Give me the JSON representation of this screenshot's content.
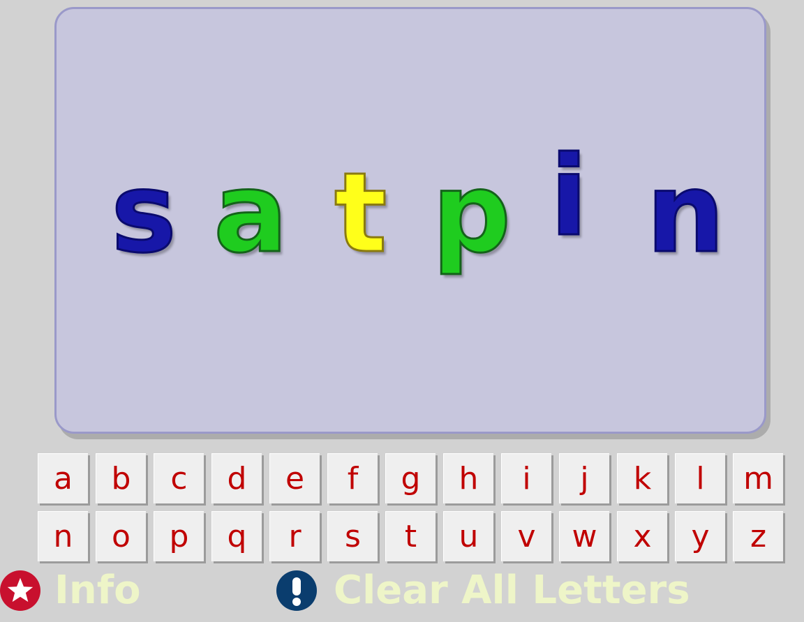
{
  "board": {
    "letters": [
      {
        "char": "s",
        "color": "#1717a8"
      },
      {
        "char": "a",
        "color": "#1fcc1f"
      },
      {
        "char": "t",
        "color": "#ffff1a"
      },
      {
        "char": "p",
        "color": "#1fcc1f"
      },
      {
        "char": "i",
        "color": "#1717a8"
      },
      {
        "char": "n",
        "color": "#1717a8"
      }
    ]
  },
  "keyboard": {
    "row1": [
      "a",
      "b",
      "c",
      "d",
      "e",
      "f",
      "g",
      "h",
      "i",
      "j",
      "k",
      "l",
      "m"
    ],
    "row2": [
      "n",
      "o",
      "p",
      "q",
      "r",
      "s",
      "t",
      "u",
      "v",
      "w",
      "x",
      "y",
      "z"
    ],
    "letter_color": "#c00000"
  },
  "footer": {
    "info_label": "Info",
    "info_icon": "star-icon",
    "clear_label": "Clear All Letters",
    "clear_icon": "exclamation-icon",
    "label_color": "#eef5c8"
  }
}
